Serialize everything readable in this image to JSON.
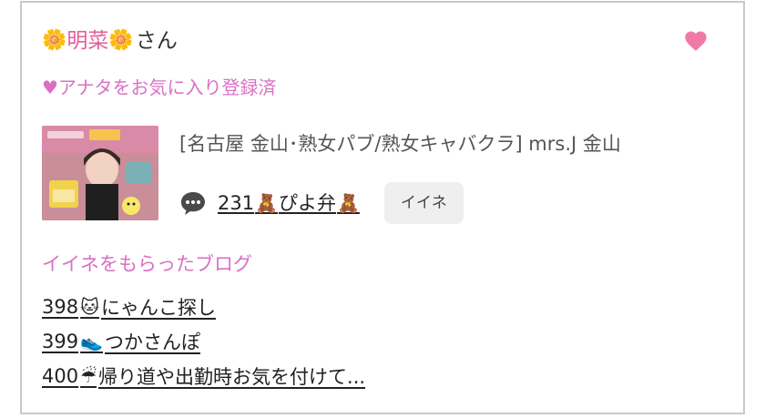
{
  "profile": {
    "flower_left": "🌼",
    "name": "明菜",
    "flower_right": "🌼",
    "suffix": "さん"
  },
  "favorite": {
    "status_text": "♥アナタをお気に入り登録済",
    "heart_color": "#f07aa4"
  },
  "shop": {
    "name": "[名古屋 金山･熟女パブ/熟女キャバクラ]  mrs.J 金山"
  },
  "blog": {
    "comment_count": "231",
    "bear_left": "🧸",
    "title": "ぴよ弁",
    "bear_right": "🧸",
    "iine_button_label": "イイネ"
  },
  "liked_section": {
    "title": "イイネをもらったブログ",
    "items": [
      {
        "number": "398",
        "emoji": "🐱",
        "title": "にゃんこ探し"
      },
      {
        "number": "399",
        "emoji": "👟",
        "title": "つかさんぽ"
      },
      {
        "number": "400",
        "emoji": "☔",
        "title": "帰り道や出勤時お気を付けて..."
      }
    ]
  },
  "colors": {
    "accent_pink": "#e45e9a",
    "link_pink": "#d970c4",
    "button_gray": "#efefef"
  }
}
